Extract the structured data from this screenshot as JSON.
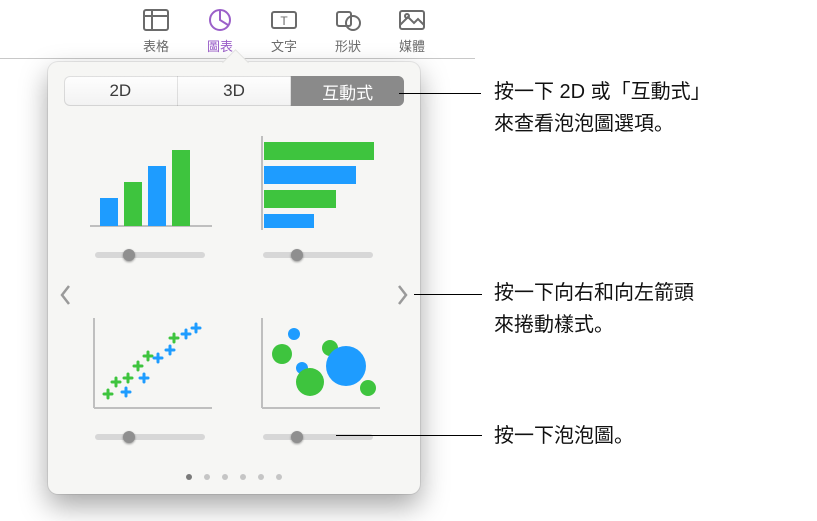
{
  "toolbar": {
    "items": [
      {
        "label": "表格",
        "icon": "table"
      },
      {
        "label": "圖表",
        "icon": "chart"
      },
      {
        "label": "文字",
        "icon": "text"
      },
      {
        "label": "形狀",
        "icon": "shape"
      },
      {
        "label": "媒體",
        "icon": "media"
      }
    ],
    "active_index": 1
  },
  "popover": {
    "segments": [
      {
        "label": "2D",
        "selected": false
      },
      {
        "label": "3D",
        "selected": false
      },
      {
        "label": "互動式",
        "selected": true
      }
    ],
    "charts": [
      {
        "name": "interactive-column-chart"
      },
      {
        "name": "interactive-bar-chart"
      },
      {
        "name": "interactive-scatter-chart"
      },
      {
        "name": "interactive-bubble-chart"
      }
    ],
    "page_dots": {
      "count": 6,
      "active": 0
    }
  },
  "callouts": {
    "c1_line1": "按一下 2D 或「互動式」",
    "c1_line2": "來查看泡泡圖選項。",
    "c2_line1": "按一下向右和向左箭頭",
    "c2_line2": "來捲動樣式。",
    "c3": "按一下泡泡圖。"
  },
  "colors": {
    "accent": "#9b60c9",
    "chart_green": "#3ec43e",
    "chart_blue": "#1e9cff"
  }
}
